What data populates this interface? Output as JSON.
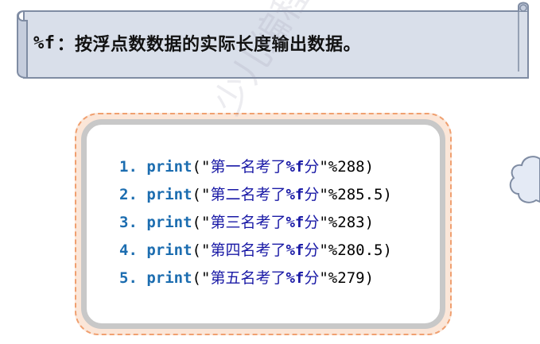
{
  "banner": {
    "code": "%f",
    "text": "：按浮点数数据的实际长度输出数据。"
  },
  "code": {
    "lines": [
      {
        "num": "1.",
        "kw": "print",
        "open": "(\"",
        "text": "第一名考了",
        "fmt": "%f",
        "text2": "分",
        "close": "\"%",
        "value": "288",
        "end": ")"
      },
      {
        "num": "2.",
        "kw": "print",
        "open": "(\"",
        "text": "第二名考了",
        "fmt": "%f",
        "text2": "分",
        "close": "\"%",
        "value": "285.5",
        "end": ")"
      },
      {
        "num": "3.",
        "kw": "print",
        "open": "(\"",
        "text": "第三名考了",
        "fmt": "%f",
        "text2": "分",
        "close": "\"%",
        "value": "283",
        "end": ")"
      },
      {
        "num": "4.",
        "kw": "print",
        "open": "(\"",
        "text": "第四名考了",
        "fmt": "%f",
        "text2": "分",
        "close": "\"%",
        "value": "280.5",
        "end": ")"
      },
      {
        "num": "5.",
        "kw": "print",
        "open": "(\"",
        "text": "第五名考了",
        "fmt": "%f",
        "text2": "分",
        "close": "\"%",
        "value": "279",
        "end": ")"
      }
    ]
  },
  "watermark": "少儿编程 f1093"
}
